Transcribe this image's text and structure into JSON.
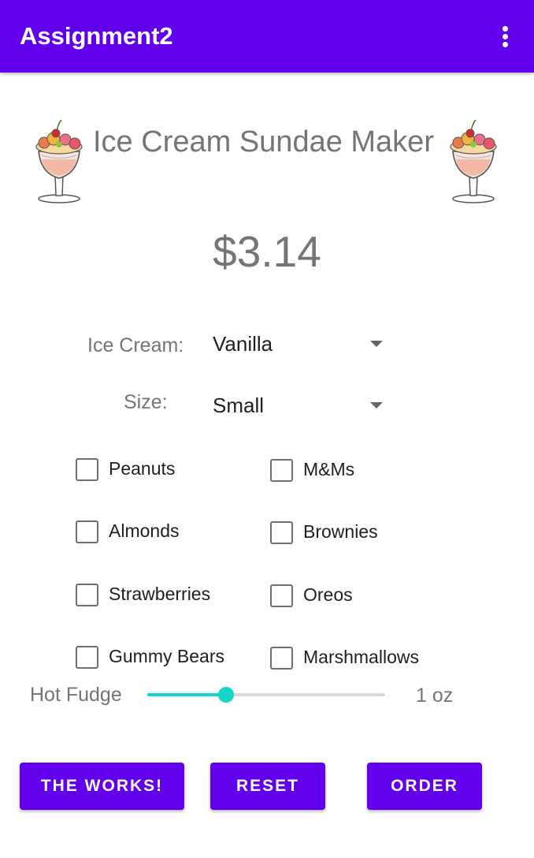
{
  "app_bar": {
    "title": "Assignment2",
    "menu_icon": "more-vert-icon",
    "color": "#6200EE"
  },
  "header": {
    "title": "Ice Cream Sundae Maker",
    "image_icon": "ice-cream-sundae-image"
  },
  "price": "$3.14",
  "selectors": {
    "ice_cream": {
      "label": "Ice Cream:",
      "value": "Vanilla"
    },
    "size": {
      "label": "Size:",
      "value": "Small"
    }
  },
  "toppings": [
    {
      "label": "Peanuts",
      "checked": false
    },
    {
      "label": "M&Ms",
      "checked": false
    },
    {
      "label": "Almonds",
      "checked": false
    },
    {
      "label": "Brownies",
      "checked": false
    },
    {
      "label": "Strawberries",
      "checked": false
    },
    {
      "label": "Oreos",
      "checked": false
    },
    {
      "label": "Gummy Bears",
      "checked": false
    },
    {
      "label": "Marshmallows",
      "checked": false
    }
  ],
  "hot_fudge": {
    "label": "Hot Fudge",
    "value_label": "1 oz",
    "fraction": 0.33,
    "accent": "#12D6C8"
  },
  "buttons": {
    "works": "THE WORKS!",
    "reset": "RESET",
    "order": "ORDER"
  }
}
